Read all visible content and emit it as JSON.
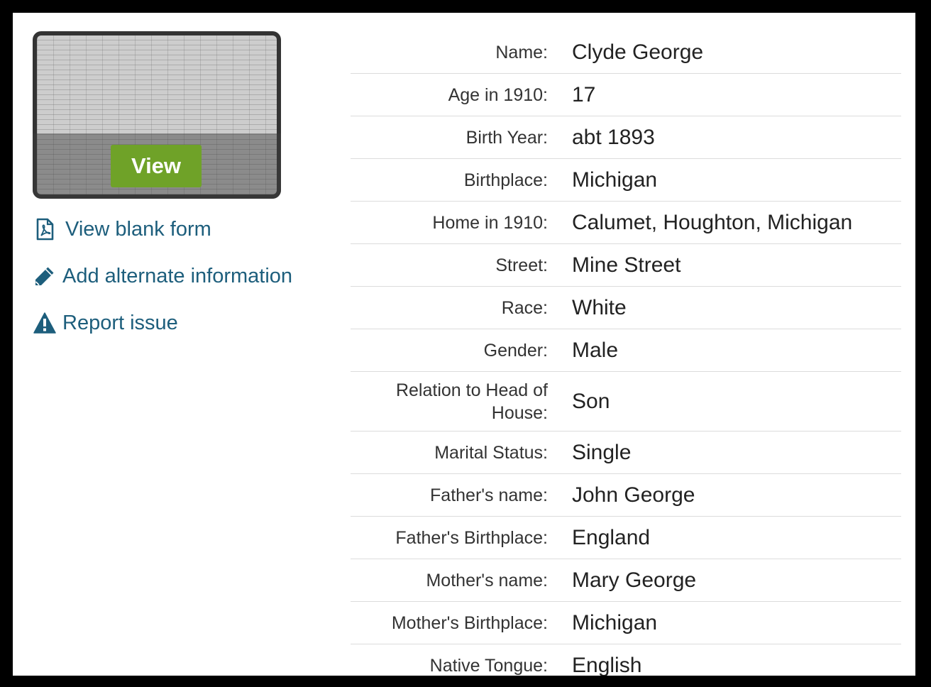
{
  "thumbnail": {
    "button_label": "View"
  },
  "actions": [
    {
      "label": "View blank form",
      "icon": "pdf-file-icon"
    },
    {
      "label": "Add alternate information",
      "icon": "pencil-icon"
    },
    {
      "label": "Report issue",
      "icon": "warning-icon"
    }
  ],
  "details": [
    {
      "label": "Name:",
      "value": "Clyde George"
    },
    {
      "label": "Age in 1910:",
      "value": "17"
    },
    {
      "label": "Birth Year:",
      "value": "abt 1893"
    },
    {
      "label": "Birthplace:",
      "value": "Michigan"
    },
    {
      "label": "Home in 1910:",
      "value": "Calumet, Houghton, Michigan"
    },
    {
      "label": "Street:",
      "value": "Mine Street"
    },
    {
      "label": "Race:",
      "value": "White"
    },
    {
      "label": "Gender:",
      "value": "Male"
    },
    {
      "label": "Relation to Head of House:",
      "value": "Son"
    },
    {
      "label": "Marital Status:",
      "value": "Single"
    },
    {
      "label": "Father's name:",
      "value": "John George"
    },
    {
      "label": "Father's Birthplace:",
      "value": "England"
    },
    {
      "label": "Mother's name:",
      "value": "Mary George"
    },
    {
      "label": "Mother's Birthplace:",
      "value": "Michigan"
    },
    {
      "label": "Native Tongue:",
      "value": "English"
    }
  ],
  "colors": {
    "link": "#1d5e7c",
    "view_button": "#6fa228"
  }
}
